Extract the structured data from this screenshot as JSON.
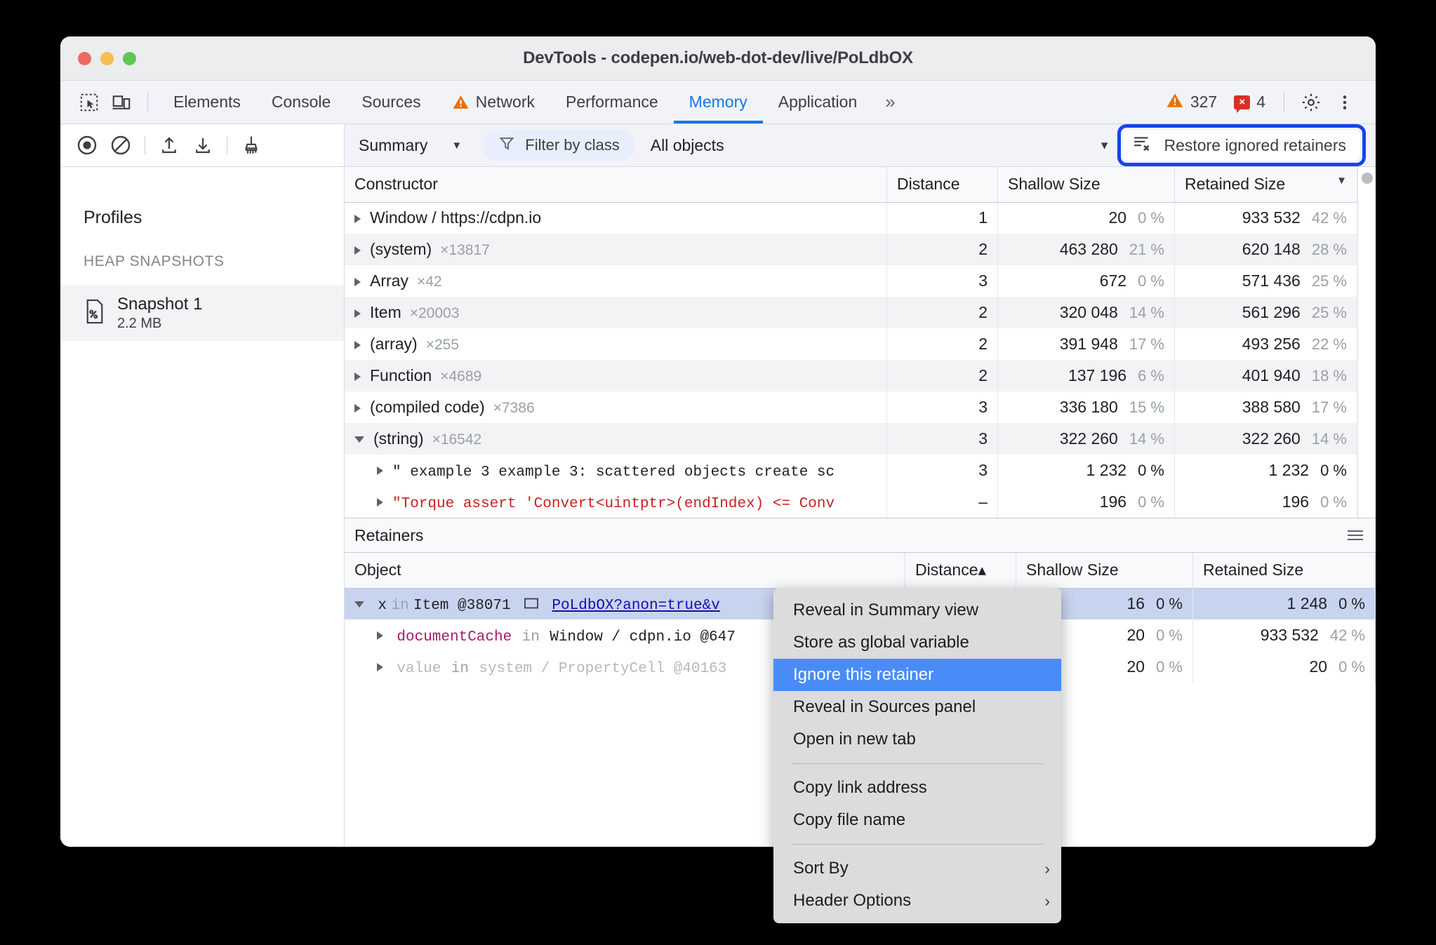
{
  "window": {
    "title": "DevTools - codepen.io/web-dot-dev/live/PoLdbOX"
  },
  "tabbar": {
    "inspect_icon": "inspect-element-icon",
    "device_icon": "device-toolbar-icon",
    "tabs": [
      {
        "label": "Elements",
        "active": false,
        "warn": false
      },
      {
        "label": "Console",
        "active": false,
        "warn": false
      },
      {
        "label": "Sources",
        "active": false,
        "warn": false
      },
      {
        "label": "Network",
        "active": false,
        "warn": true
      },
      {
        "label": "Performance",
        "active": false,
        "warn": false
      },
      {
        "label": "Memory",
        "active": true,
        "warn": false
      },
      {
        "label": "Application",
        "active": false,
        "warn": false
      }
    ],
    "more_tabs": "»",
    "warning_count": "327",
    "error_count": "4",
    "error_badge_glyph": "×",
    "settings_icon": "gear-icon",
    "more_icon": "kebab-menu-icon"
  },
  "sidebar": {
    "heading": "Profiles",
    "section": "HEAP SNAPSHOTS",
    "snapshots": [
      {
        "name": "Snapshot 1",
        "size": "2.2 MB",
        "icon": "heap-snapshot-file-icon"
      }
    ]
  },
  "toolbar": {
    "record_icon": "record-icon",
    "clear_icon": "clear-icon",
    "load_icon": "upload-profile-icon",
    "save_icon": "download-profile-icon",
    "collect_garbage_icon": "collect-garbage-broom-icon",
    "view_select": "Summary",
    "filter_label": "Filter by class",
    "filter_icon": "filter-funnel-icon",
    "objects_select": "All objects",
    "objects_caret": "▾",
    "restore_label": "Restore ignored retainers",
    "restore_icon": "restore-ignored-retainers-icon"
  },
  "constructors": {
    "columns": [
      "Constructor",
      "Distance",
      "Shallow Size",
      "Retained Size"
    ],
    "sort_column": "Retained Size",
    "sort_dir": "desc",
    "rows": [
      {
        "name": "Window / https://cdpn.io",
        "count": "",
        "distance": "1",
        "shallow": "20",
        "shallow_pct": "0 %",
        "retained": "933 532",
        "retained_pct": "42 %",
        "expanded": false,
        "style": "normal"
      },
      {
        "name": "(system)",
        "count": "×13817",
        "distance": "2",
        "shallow": "463 280",
        "shallow_pct": "21 %",
        "retained": "620 148",
        "retained_pct": "28 %",
        "expanded": false,
        "style": "normal"
      },
      {
        "name": "Array",
        "count": "×42",
        "distance": "3",
        "shallow": "672",
        "shallow_pct": "0 %",
        "retained": "571 436",
        "retained_pct": "25 %",
        "expanded": false,
        "style": "normal"
      },
      {
        "name": "Item",
        "count": "×20003",
        "distance": "2",
        "shallow": "320 048",
        "shallow_pct": "14 %",
        "retained": "561 296",
        "retained_pct": "25 %",
        "expanded": false,
        "style": "normal"
      },
      {
        "name": "(array)",
        "count": "×255",
        "distance": "2",
        "shallow": "391 948",
        "shallow_pct": "17 %",
        "retained": "493 256",
        "retained_pct": "22 %",
        "expanded": false,
        "style": "normal"
      },
      {
        "name": "Function",
        "count": "×4689",
        "distance": "2",
        "shallow": "137 196",
        "shallow_pct": "6 %",
        "retained": "401 940",
        "retained_pct": "18 %",
        "expanded": false,
        "style": "normal"
      },
      {
        "name": "(compiled code)",
        "count": "×7386",
        "distance": "3",
        "shallow": "336 180",
        "shallow_pct": "15 %",
        "retained": "388 580",
        "retained_pct": "17 %",
        "expanded": false,
        "style": "normal"
      },
      {
        "name": "(string)",
        "count": "×16542",
        "distance": "3",
        "shallow": "322 260",
        "shallow_pct": "14 %",
        "retained": "322 260",
        "retained_pct": "14 %",
        "expanded": true,
        "style": "normal"
      },
      {
        "name": "\" example 3 example 3: scattered objects create sc",
        "count": "",
        "distance": "3",
        "shallow": "1 232",
        "shallow_pct": "0 %",
        "retained": "1 232",
        "retained_pct": "0 %",
        "expanded": false,
        "style": "child-mono"
      },
      {
        "name": "\"Torque assert 'Convert<uintptr>(endIndex) <= Conv",
        "count": "",
        "distance": "–",
        "shallow": "196",
        "shallow_pct": "0 %",
        "retained": "196",
        "retained_pct": "0 %",
        "expanded": false,
        "style": "child-mono-red"
      }
    ]
  },
  "retainers": {
    "panel_title": "Retainers",
    "menu_icon": "retainers-options-icon",
    "columns": [
      "Object",
      "Distance▴",
      "Shallow Size",
      "Retained Size"
    ],
    "rows": [
      {
        "prefix": "x",
        "kw": "in",
        "object": "Item @38071",
        "chip_icon": "node-chip-icon",
        "link": "PoLdbOX?anon=true&v",
        "distance": "",
        "shallow": "16",
        "shallow_pct": "0 %",
        "retained": "1 248",
        "retained_pct": "0 %",
        "selected": true,
        "expanded": true,
        "style": "link-row"
      },
      {
        "prefix": "documentCache",
        "kw": "in",
        "object": "Window / cdpn.io @647",
        "link": "",
        "distance": "",
        "shallow": "20",
        "shallow_pct": "0 %",
        "retained": "933 532",
        "retained_pct": "42 %",
        "selected": false,
        "expanded": false,
        "style": "prop-row"
      },
      {
        "prefix": "value",
        "kw": "in",
        "object": "system / PropertyCell @40163",
        "link": "",
        "distance": "",
        "shallow": "20",
        "shallow_pct": "0 %",
        "retained": "20",
        "retained_pct": "0 %",
        "selected": false,
        "expanded": false,
        "style": "dim-row"
      }
    ]
  },
  "context_menu": {
    "items": [
      {
        "label": "Reveal in Summary view",
        "highlighted": false,
        "submenu": false,
        "separator_after": false
      },
      {
        "label": "Store as global variable",
        "highlighted": false,
        "submenu": false,
        "separator_after": false
      },
      {
        "label": "Ignore this retainer",
        "highlighted": true,
        "submenu": false,
        "separator_after": false
      },
      {
        "label": "Reveal in Sources panel",
        "highlighted": false,
        "submenu": false,
        "separator_after": false
      },
      {
        "label": "Open in new tab",
        "highlighted": false,
        "submenu": false,
        "separator_after": true
      },
      {
        "label": "Copy link address",
        "highlighted": false,
        "submenu": false,
        "separator_after": false
      },
      {
        "label": "Copy file name",
        "highlighted": false,
        "submenu": false,
        "separator_after": true
      },
      {
        "label": "Sort By",
        "highlighted": false,
        "submenu": true,
        "separator_after": false
      },
      {
        "label": "Header Options",
        "highlighted": false,
        "submenu": true,
        "separator_after": false
      }
    ],
    "submenu_arrow": "›"
  },
  "colors": {
    "accent": "#1a73e8",
    "highlight_box": "#1744e8",
    "menu_highlight": "#4a8cf7",
    "warning": "#e8710a",
    "error": "#d93025",
    "link": "#1a0dab",
    "selection": "#c8d4ef"
  }
}
